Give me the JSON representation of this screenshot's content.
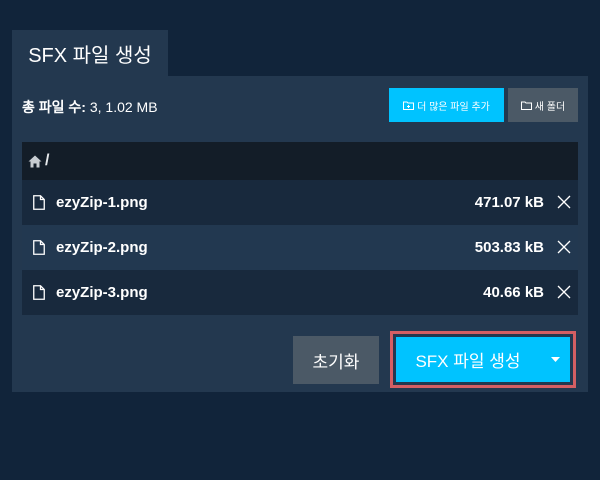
{
  "tab": {
    "label": "SFX 파일 생성"
  },
  "summary": {
    "label": "총 파일 수:",
    "value": " 3, 1.02 MB"
  },
  "toolbar": {
    "add_files_label": "더 많은 파일 추가",
    "new_folder_label": "새 폴더"
  },
  "breadcrumb": {
    "path": "/"
  },
  "files": [
    {
      "name": "ezyZip-1.png",
      "size": "471.07 kB"
    },
    {
      "name": "ezyZip-2.png",
      "size": "503.83 kB"
    },
    {
      "name": "ezyZip-3.png",
      "size": "40.66 kB"
    }
  ],
  "actions": {
    "reset_label": "초기화",
    "create_label": "SFX 파일 생성"
  },
  "colors": {
    "page_background": "#11243a",
    "panel_background": "#23384f",
    "accent": "#00c3ff",
    "secondary_button": "#4b5966",
    "highlight_outline": "#d45f63"
  },
  "icons": [
    "folder-plus-icon",
    "folder-icon",
    "home-icon",
    "file-icon",
    "close-icon",
    "caret-down-icon"
  ]
}
